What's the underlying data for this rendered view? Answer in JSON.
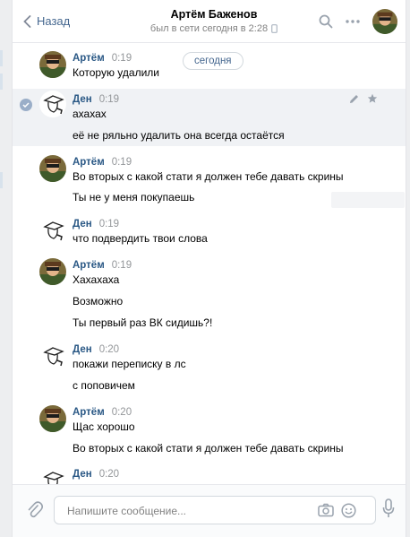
{
  "header": {
    "back_label": "Назад",
    "name": "Артём Баженов",
    "status": "был в сети сегодня в 2:28"
  },
  "date_pill": "сегодня",
  "messages": [
    {
      "author": "Артём",
      "time": "0:19",
      "avatar": "artem",
      "lines": [
        "Которую удалили"
      ]
    },
    {
      "author": "Ден",
      "time": "0:19",
      "avatar": "den",
      "selected": true,
      "lines": [
        "ахахах",
        "её не ряльно удалить она всегда остаётся"
      ]
    },
    {
      "author": "Артём",
      "time": "0:19",
      "avatar": "artem",
      "lines": [
        "Во вторых с какой стати я должен тебе давать скрины",
        "Ты не у меня покупаешь"
      ]
    },
    {
      "author": "Ден",
      "time": "0:19",
      "avatar": "den",
      "lines": [
        "что подвердить твои слова"
      ]
    },
    {
      "author": "Артём",
      "time": "0:19",
      "avatar": "artem",
      "lines": [
        "Хахахаха",
        "Возможно",
        "Ты первый раз ВК сидишь?!"
      ]
    },
    {
      "author": "Ден",
      "time": "0:20",
      "avatar": "den",
      "lines": [
        "покажи переписку в лс",
        "с поповичем"
      ]
    },
    {
      "author": "Артём",
      "time": "0:20",
      "avatar": "artem",
      "lines": [
        "Щас хорошо",
        "Во вторых с какой стати я должен тебе давать скрины"
      ]
    },
    {
      "author": "Ден",
      "time": "0:20",
      "avatar": "den",
      "lines": []
    }
  ],
  "composer": {
    "placeholder": "Напишите сообщение..."
  },
  "icons": {
    "back": "chevron-left-icon",
    "search": "search-icon",
    "more": "more-dots-icon",
    "mobile": "mobile-phone-icon",
    "attach": "paperclip-icon",
    "camera": "camera-icon",
    "emoji": "smile-icon",
    "mic": "microphone-icon",
    "edit": "pencil-icon",
    "star": "star-icon",
    "selected": "checkmark-icon"
  },
  "colors": {
    "link": "#2a5885",
    "accent": "#45678f",
    "muted": "#939699"
  }
}
